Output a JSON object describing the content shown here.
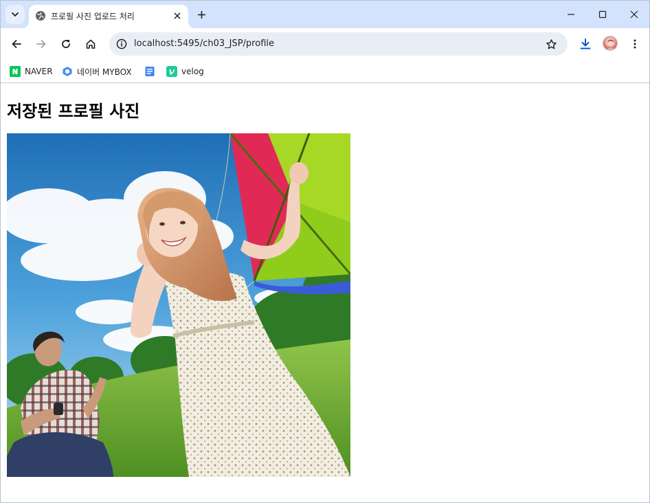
{
  "tab": {
    "title": "프로필 사진 업로드 처리"
  },
  "address_bar": {
    "url": "localhost:5495/ch03_JSP/profile"
  },
  "bookmarks": [
    {
      "label": "NAVER",
      "icon": "naver-icon"
    },
    {
      "label": "네이버 MYBOX",
      "icon": "mybox-icon"
    },
    {
      "label": "",
      "icon": "docs-icon"
    },
    {
      "label": "velog",
      "icon": "velog-icon"
    }
  ],
  "page": {
    "heading": "저장된 프로필 사진"
  },
  "colors": {
    "tabstrip": "#d3e3fd",
    "omnibox": "#e9eef6",
    "naver_green": "#03c75a",
    "mybox_blue": "#4a8cf7",
    "docs_blue": "#4285f4",
    "velog_teal": "#20c997"
  }
}
